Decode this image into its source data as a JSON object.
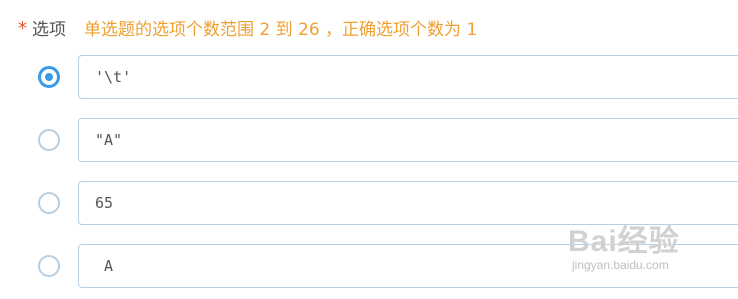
{
  "header": {
    "required_mark": "*",
    "label": "选项",
    "hint": "单选题的选项个数范围 2 到 26 ，正确选项个数为 1"
  },
  "options": [
    {
      "value": "'\\t'",
      "selected": true
    },
    {
      "value": "\"A\"",
      "selected": false
    },
    {
      "value": "65",
      "selected": false
    },
    {
      "value": " A",
      "selected": false
    }
  ],
  "watermark": {
    "logo_text": "Bai经验",
    "url": "jingyan.baidu.com"
  },
  "colors": {
    "accent": "#3a9ae8",
    "hint": "#f0a030",
    "required": "#e4572e",
    "input_border": "#b9cfe2"
  }
}
